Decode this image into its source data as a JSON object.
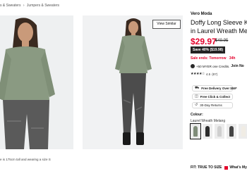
{
  "breadcrumb": {
    "items": [
      "s & Sweaters",
      "Jumpers & Sweaters"
    ],
    "separator": "›"
  },
  "gallery": {
    "view_similar": "View Similar",
    "caption": "e is 175cm tall and wearing a size S"
  },
  "product": {
    "brand": "Vero Moda",
    "title_line1": "Doffy Long Sleeve K",
    "title_line2": "in Laurel Wreath Me",
    "price": "$29.97",
    "was_price": "$49.95",
    "save_badge": "Save 40% ($19.98)",
    "sale_ends_label": "Sale ends: Tomorrow",
    "sale_ends_count": "34h",
    "credits_text": "+50 MYER one Credits.",
    "credits_join": "Join No",
    "rating_stars": "★★★★☆",
    "rating_value": "4.5",
    "rating_count": "(87)"
  },
  "options": {
    "free_delivery": "Free Delivery Over $59*",
    "click_collect": "Free Click & Collect",
    "returns": "30-Day Returns"
  },
  "colour": {
    "label": "Colour:",
    "selected_name": "Laurel Wreath Melang",
    "swatch_colors": [
      "#7f8c79",
      "#2c2c2c",
      "#cfcfcf",
      "#444444",
      "#f0ece4",
      "#3a3a3a"
    ]
  },
  "fit": {
    "label": "FIT: TRUE TO SIZE",
    "whats_my_size": "What's My"
  },
  "colors": {
    "sale_red": "#e4002b",
    "knit_green": "#8a9a82",
    "denim_grey": "#5a5a5a"
  }
}
